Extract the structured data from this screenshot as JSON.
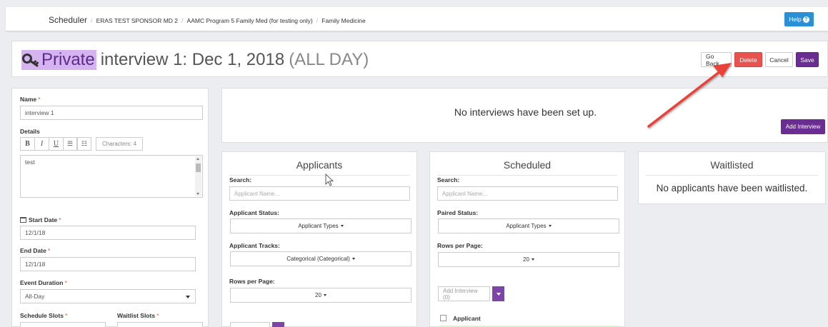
{
  "breadcrumb": {
    "app": "Scheduler",
    "items": [
      "ERAS TEST SPONSOR MD 2",
      "AAMC Program 5 Family Med (for testing only)",
      "Family Medicine"
    ],
    "separator": "/"
  },
  "help": {
    "label": "Help"
  },
  "header": {
    "private_label": "Private",
    "title": "interview 1: Dec 1, 2018",
    "all_day": "(ALL DAY)",
    "buttons": {
      "go_back": "Go Back",
      "delete": "Delete",
      "cancel": "Cancel",
      "save": "Save"
    }
  },
  "form": {
    "name_label": "Name",
    "required_mark": "*",
    "name_value": "interview 1",
    "details_label": "Details",
    "toolbar": {
      "bold": "B",
      "italic": "I",
      "underline": "U",
      "characters": "Characters: 4"
    },
    "details_value": "test",
    "start_date_label": "Start Date",
    "start_date_value": "12/1/18",
    "end_date_label": "End Date",
    "end_date_value": "12/1/18",
    "event_duration_label": "Event Duration",
    "event_duration_value": "All-Day",
    "schedule_slots_label": "Schedule Slots",
    "waitlist_slots_label": "Waitlist Slots"
  },
  "interviews": {
    "empty_message": "No interviews have been set up.",
    "add_button": "Add Interview"
  },
  "applicants": {
    "title": "Applicants",
    "search_label": "Search:",
    "search_placeholder": "Applicant Name...",
    "status_label": "Applicant Status:",
    "status_value": "Applicant Types",
    "tracks_label": "Applicant Tracks:",
    "tracks_value": "Categorical (Categorical)",
    "rows_label": "Rows per Page:",
    "rows_value": "20"
  },
  "scheduled": {
    "title": "Scheduled",
    "search_label": "Search:",
    "search_placeholder": "Applicant Name...",
    "paired_label": "Paired Status:",
    "paired_value": "Applicant Types",
    "rows_label": "Rows per Page:",
    "rows_value": "20",
    "add_interview": "Add Interview (0)",
    "column_applicant": "Applicant"
  },
  "waitlisted": {
    "title": "Waitlisted",
    "empty_message": "No applicants have been waitlisted."
  },
  "colors": {
    "purple": "#6a2d91",
    "delete_red": "#e8534f",
    "help_blue": "#2a8fd6",
    "highlight": "#d5b2f0",
    "arrow_red": "#e8423a"
  }
}
